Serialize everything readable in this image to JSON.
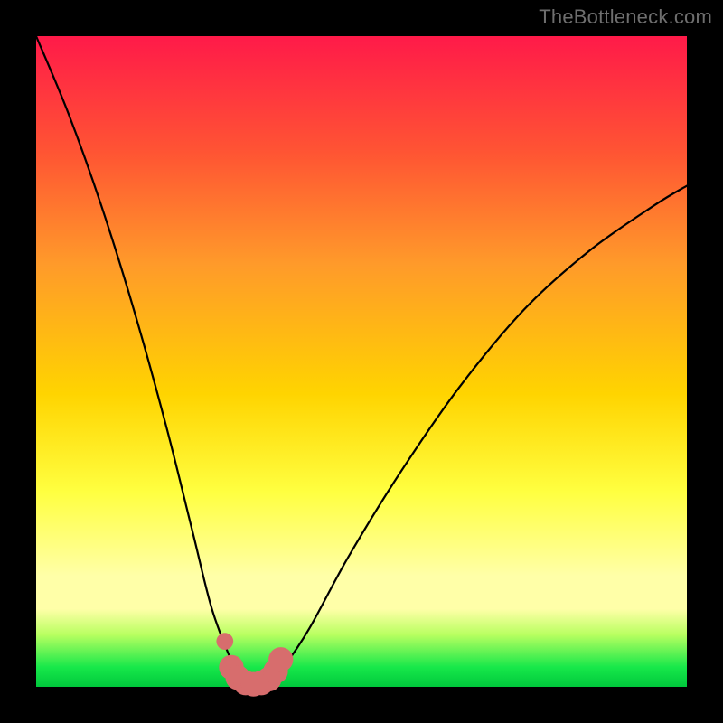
{
  "watermark": {
    "text": "TheBottleneck.com"
  },
  "colors": {
    "frame_bg": "#000000",
    "gradient_top": "#ff1a49",
    "gradient_mid1": "#ff7a2e",
    "gradient_mid2": "#ffd400",
    "gradient_mid3": "#ffff40",
    "gradient_band": "#ffffa8",
    "gradient_green": "#17e84a",
    "curve_stroke": "#000000",
    "marker_fill": "#d76d6d",
    "marker_stroke": "#c95a5a"
  },
  "layout": {
    "plot_style": "background: linear-gradient(to bottom, #ff1a49 0%, #ff5533 18%, #ff9a2a 35%, #ffd400 55%, #ffff40 70%, #ffffa8 83%, #ffffa8 88%, #b8ff60 92%, #17e84a 97%, #00c83c 100%);"
  },
  "chart_data": {
    "type": "line",
    "title": "",
    "xlabel": "",
    "ylabel": "",
    "xlim": [
      0,
      100
    ],
    "ylim": [
      0,
      100
    ],
    "grid": false,
    "series": [
      {
        "name": "bottleneck-curve",
        "x": [
          0,
          5,
          10,
          15,
          20,
          24,
          27,
          30,
          31.5,
          33,
          34.5,
          36,
          38,
          42,
          48,
          56,
          65,
          75,
          85,
          95,
          100
        ],
        "y": [
          100,
          88,
          74,
          58,
          40,
          24,
          12,
          4,
          1.2,
          0.4,
          0.4,
          1.0,
          3,
          9,
          20,
          33,
          46,
          58,
          67,
          74,
          77
        ]
      }
    ],
    "markers": {
      "name": "highlight-band",
      "shape": "round",
      "points": [
        {
          "x": 29.0,
          "y": 7.0,
          "r": 1.3
        },
        {
          "x": 30.0,
          "y": 3.0,
          "r": 1.9
        },
        {
          "x": 31.0,
          "y": 1.4,
          "r": 1.9
        },
        {
          "x": 32.2,
          "y": 0.6,
          "r": 1.9
        },
        {
          "x": 33.4,
          "y": 0.4,
          "r": 1.9
        },
        {
          "x": 34.6,
          "y": 0.6,
          "r": 1.9
        },
        {
          "x": 35.8,
          "y": 1.2,
          "r": 1.9
        },
        {
          "x": 36.8,
          "y": 2.4,
          "r": 1.9
        },
        {
          "x": 37.6,
          "y": 4.2,
          "r": 1.9
        }
      ]
    }
  }
}
